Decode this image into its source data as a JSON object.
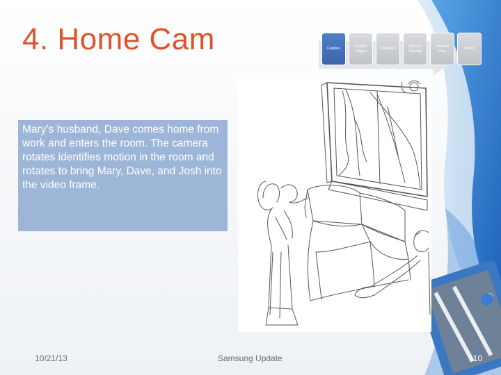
{
  "slide": {
    "title": "4. Home Cam",
    "steps": [
      {
        "label": "Capture",
        "active": true
      },
      {
        "label": "Sense/ Trigger",
        "active": false
      },
      {
        "label": "(Validate)",
        "active": false
      },
      {
        "label": "Store & Classify",
        "active": false
      },
      {
        "label": "Access/ View",
        "active": false
      },
      {
        "label": "Share",
        "active": false
      }
    ],
    "description": "Mary’s husband, Dave comes home from work and enters the room. The camera rotates identifies motion in the room and rotates to bring Mary, Dave, and Josh into the video frame.",
    "footer": {
      "date": "10/21/13",
      "center": "Samsung Update",
      "page": "110"
    }
  },
  "colors": {
    "title": "#e0522a",
    "textbox_bg": "#9db6d8",
    "step_active": "#3a64ad",
    "step_inactive": "#c6c8cc",
    "swoosh_blue": "#2e78c8"
  }
}
